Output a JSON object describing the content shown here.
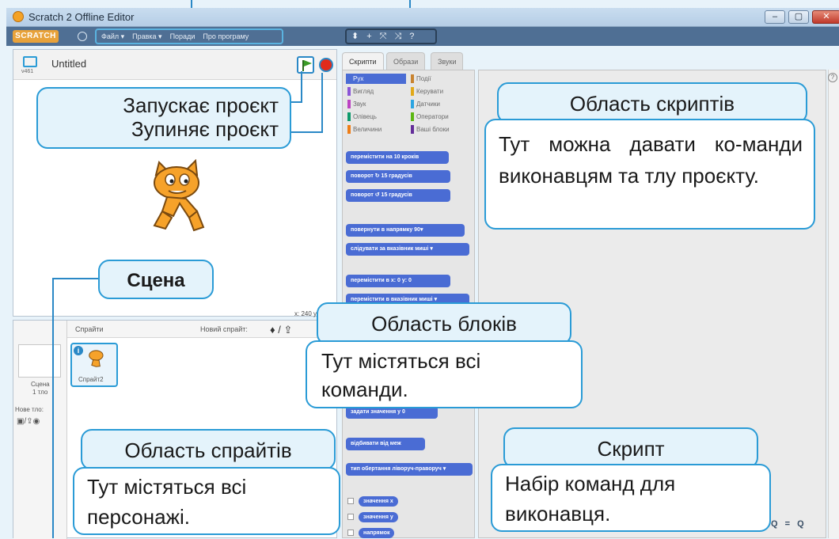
{
  "window": {
    "title": "Scratch 2 Offline Editor",
    "min": "–",
    "max": "▢",
    "close": "✕"
  },
  "menubar": {
    "brand": "SCRATCH",
    "menus": [
      "Файл ▾",
      "Правка ▾",
      "Поради",
      "Про програму"
    ],
    "tools": [
      "⬍",
      "+",
      "⤧",
      "⤨",
      "?"
    ]
  },
  "stage": {
    "project_title": "Untitled",
    "version": "v461",
    "coords": "x: 240  y: -"
  },
  "sprites": {
    "header": "Спрайти",
    "new_sprite": "Новий спрайт:",
    "stage_label": "Сцена",
    "stage_sub": "1 тло",
    "new_backdrop": "Нове тло:",
    "sprite_name": "Спрайт2"
  },
  "tabs": [
    "Скрипти",
    "Образи",
    "Звуки"
  ],
  "categories": [
    {
      "label": "Рух",
      "color": "#4a6cd4",
      "selected": true
    },
    {
      "label": "Події",
      "color": "#c88330"
    },
    {
      "label": "Вигляд",
      "color": "#8a55d7"
    },
    {
      "label": "Керувати",
      "color": "#e1a91a"
    },
    {
      "label": "Звук",
      "color": "#bb42c3"
    },
    {
      "label": "Датчики",
      "color": "#2ca5e2"
    },
    {
      "label": "Олівець",
      "color": "#0e9a6c"
    },
    {
      "label": "Оператори",
      "color": "#5cb712"
    },
    {
      "label": "Величини",
      "color": "#ee7d16"
    },
    {
      "label": "Ваші блоки",
      "color": "#632d99"
    }
  ],
  "blocks": [
    "перемістити на 10 кроків",
    "поворот ↻ 15 градусів",
    "поворот ↺ 15 градусів",
    "повернути в напрямку 90▾",
    "слідувати за вказівник миші ▾",
    "перемістити в x: 0 y: 0",
    "перемістити в вказівник миші ▾",
    "задати значення у 0",
    "відбивати від меж",
    "тип обертання ліворуч-праворуч ▾"
  ],
  "reporters": [
    "значення x",
    "значення у",
    "напрямок"
  ],
  "zoom": "Q = Q",
  "callouts": {
    "run": "Запускає проєкт",
    "stop": "Зупиняє проєкт",
    "scene": "Сцена",
    "scripts_title": "Область скриптів",
    "scripts_body": "Тут можна давати ко-манди виконавцям та тлу проєкту.",
    "blocks_title": "Область блоків",
    "blocks_body": "Тут містяться всі команди.",
    "sprites_title": "Область спрайтів",
    "sprites_body": "Тут містяться всі персонажі.",
    "script_title": "Скрипт",
    "script_body": "Набір команд для виконавця."
  }
}
